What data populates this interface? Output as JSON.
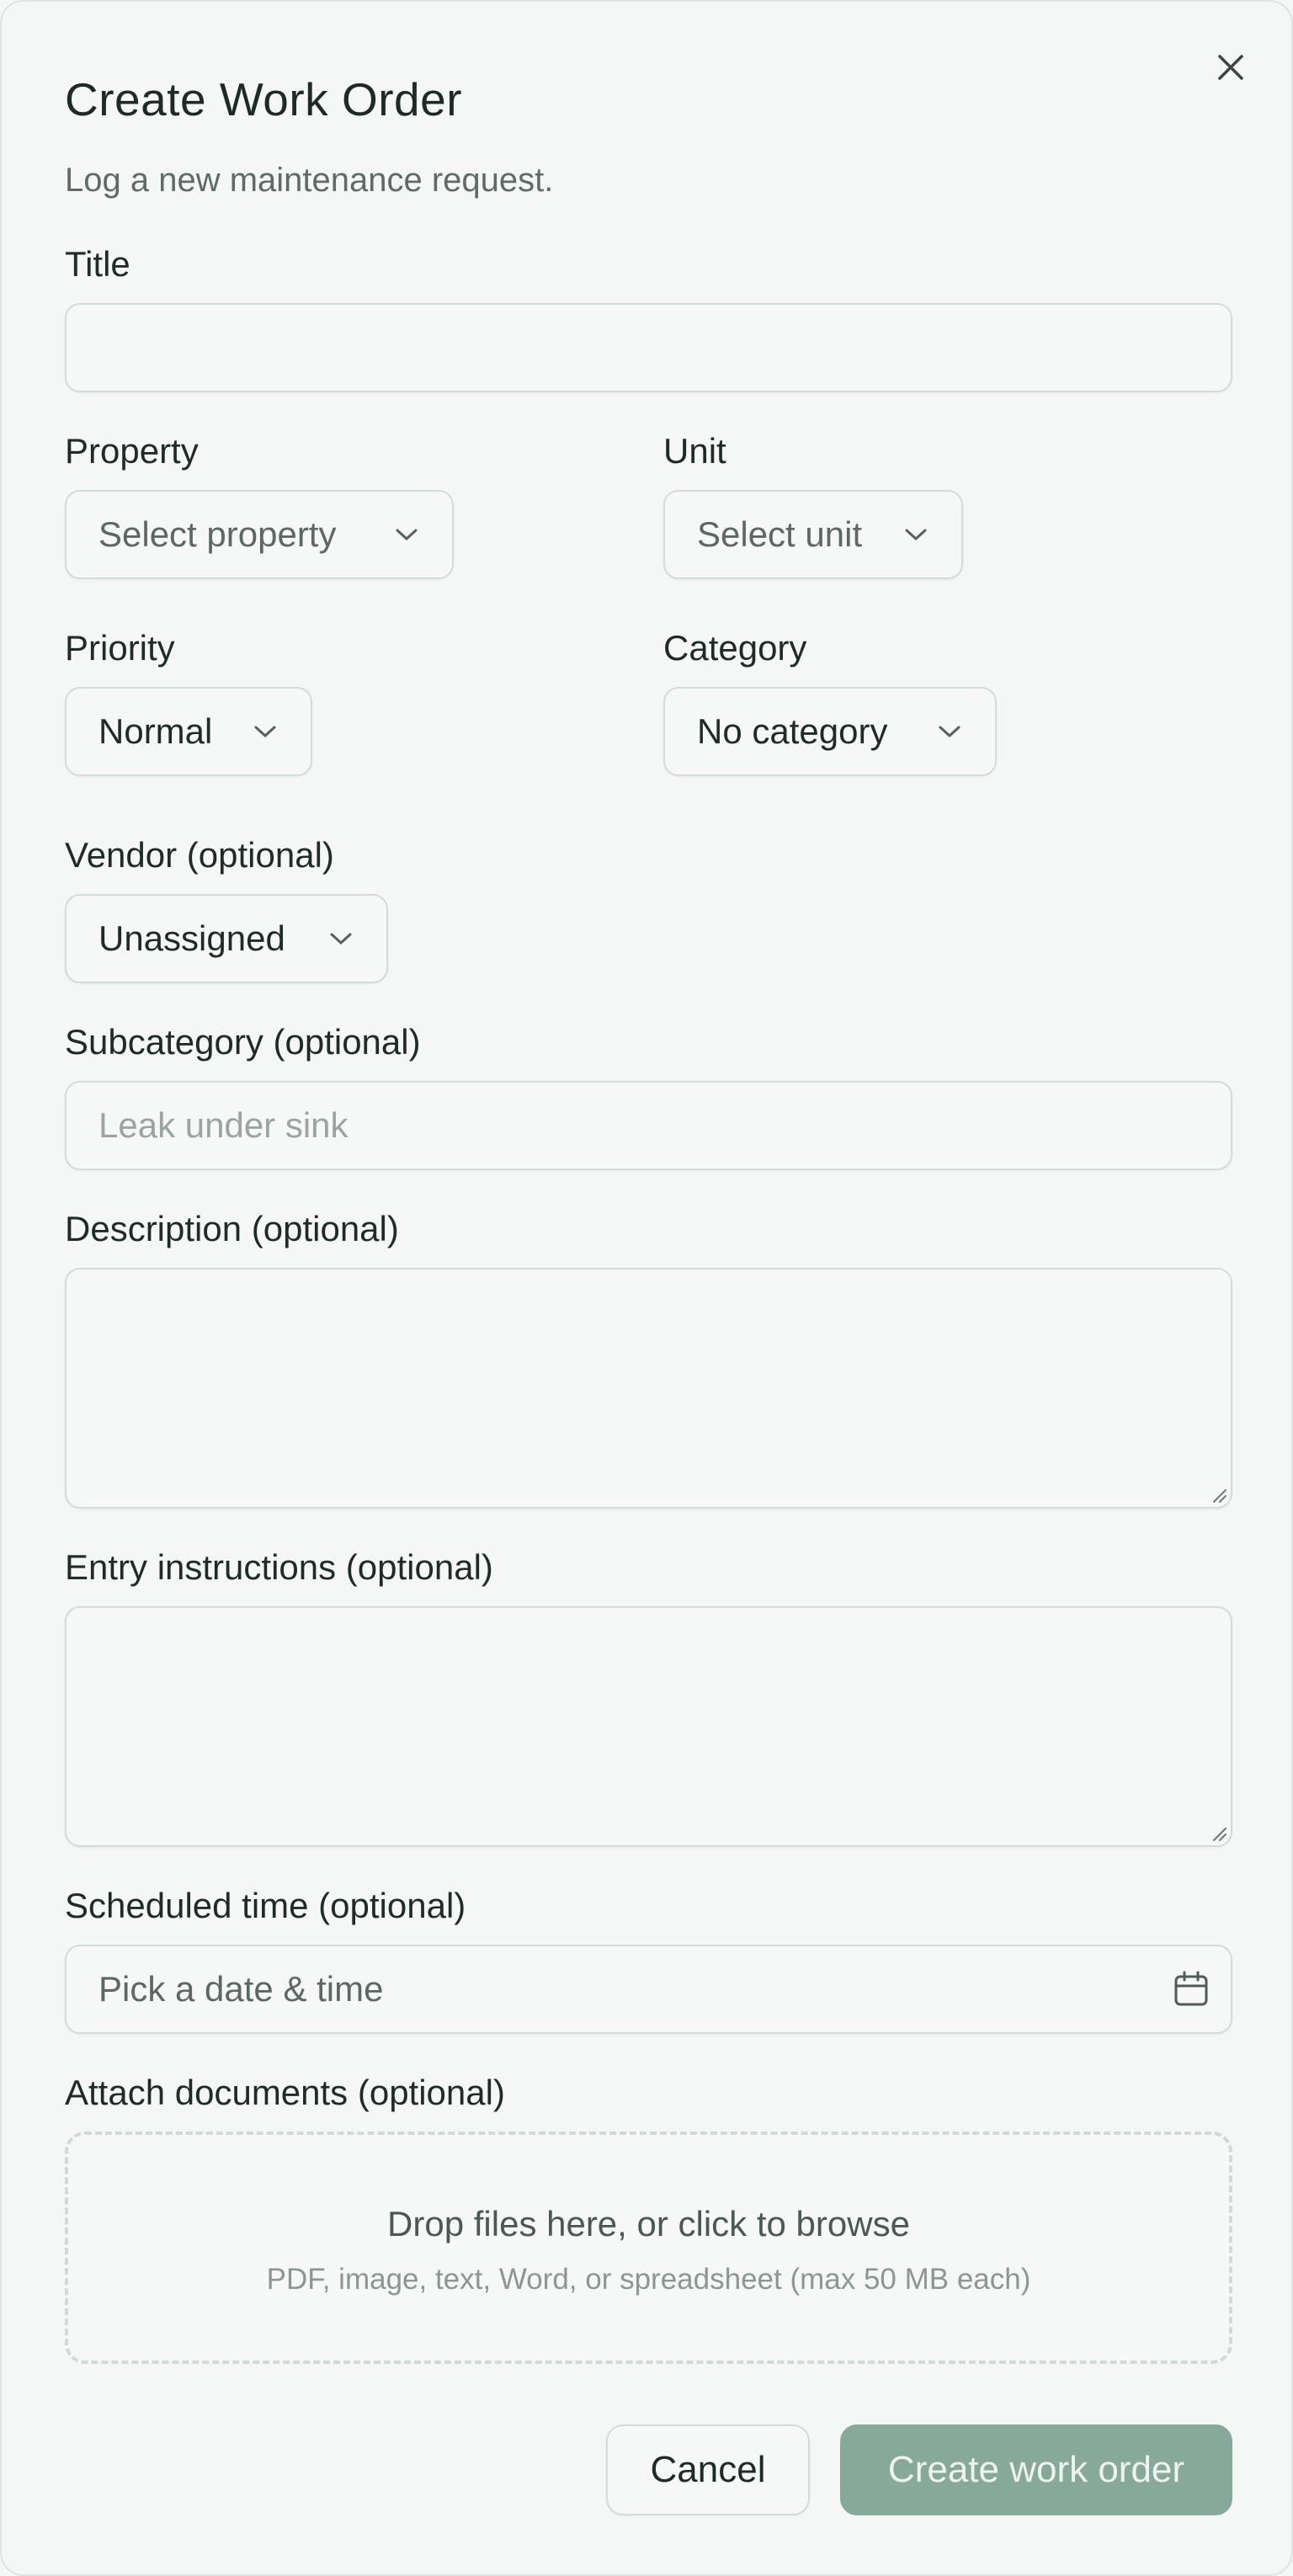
{
  "dialog": {
    "title": "Create Work Order",
    "subtitle": "Log a new maintenance request.",
    "close_icon": "close-icon"
  },
  "fields": {
    "title": {
      "label": "Title",
      "value": ""
    },
    "property": {
      "label": "Property",
      "value": "Select property"
    },
    "unit": {
      "label": "Unit",
      "value": "Select unit"
    },
    "priority": {
      "label": "Priority",
      "value": "Normal"
    },
    "category": {
      "label": "Category",
      "value": "No category"
    },
    "vendor": {
      "label": "Vendor (optional)",
      "value": "Unassigned"
    },
    "subcategory": {
      "label": "Subcategory (optional)",
      "placeholder": "Leak under sink"
    },
    "description": {
      "label": "Description (optional)",
      "value": ""
    },
    "entry_instructions": {
      "label": "Entry instructions (optional)",
      "value": ""
    },
    "scheduled_time": {
      "label": "Scheduled time (optional)",
      "placeholder": "Pick a date & time",
      "icon": "calendar-icon"
    },
    "attachments": {
      "label": "Attach documents (optional)",
      "drop_text": "Drop files here, or click to browse",
      "hint": "PDF, image, text, Word, or spreadsheet (max 50 MB each)"
    }
  },
  "actions": {
    "cancel_label": "Cancel",
    "submit_label": "Create work order"
  },
  "colors": {
    "primary_button": "#86a99c",
    "background": "#f5f7f6",
    "border": "#d5dbd8"
  }
}
